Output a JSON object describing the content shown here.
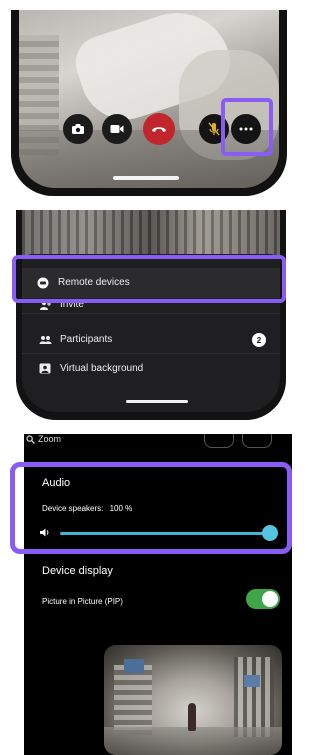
{
  "panel1": {
    "controls": [
      {
        "icon": "camera-icon"
      },
      {
        "icon": "video-icon"
      },
      {
        "icon": "hang-up-icon",
        "color": "#c1262d"
      },
      {
        "icon": "mic-muted-icon",
        "color": "#e0b020"
      },
      {
        "icon": "more-icon"
      }
    ],
    "highlight_color": "#8a5cf6"
  },
  "panel2": {
    "menu": {
      "remote_devices": "Remote devices",
      "invite": "Invite",
      "participants": "Participants",
      "participants_count": "2",
      "virtual_background": "Virtual background"
    }
  },
  "panel3": {
    "zoom_label": "Zoom",
    "audio": {
      "title": "Audio",
      "speakers_label": "Device speakers:",
      "speakers_value": "100 %",
      "volume_fraction": 1.0,
      "accent": "#3fb6d6"
    },
    "device_display": {
      "title": "Device display",
      "pip_label": "Picture in Picture (PIP)",
      "pip_enabled": true,
      "toggle_color": "#3fa548"
    }
  }
}
